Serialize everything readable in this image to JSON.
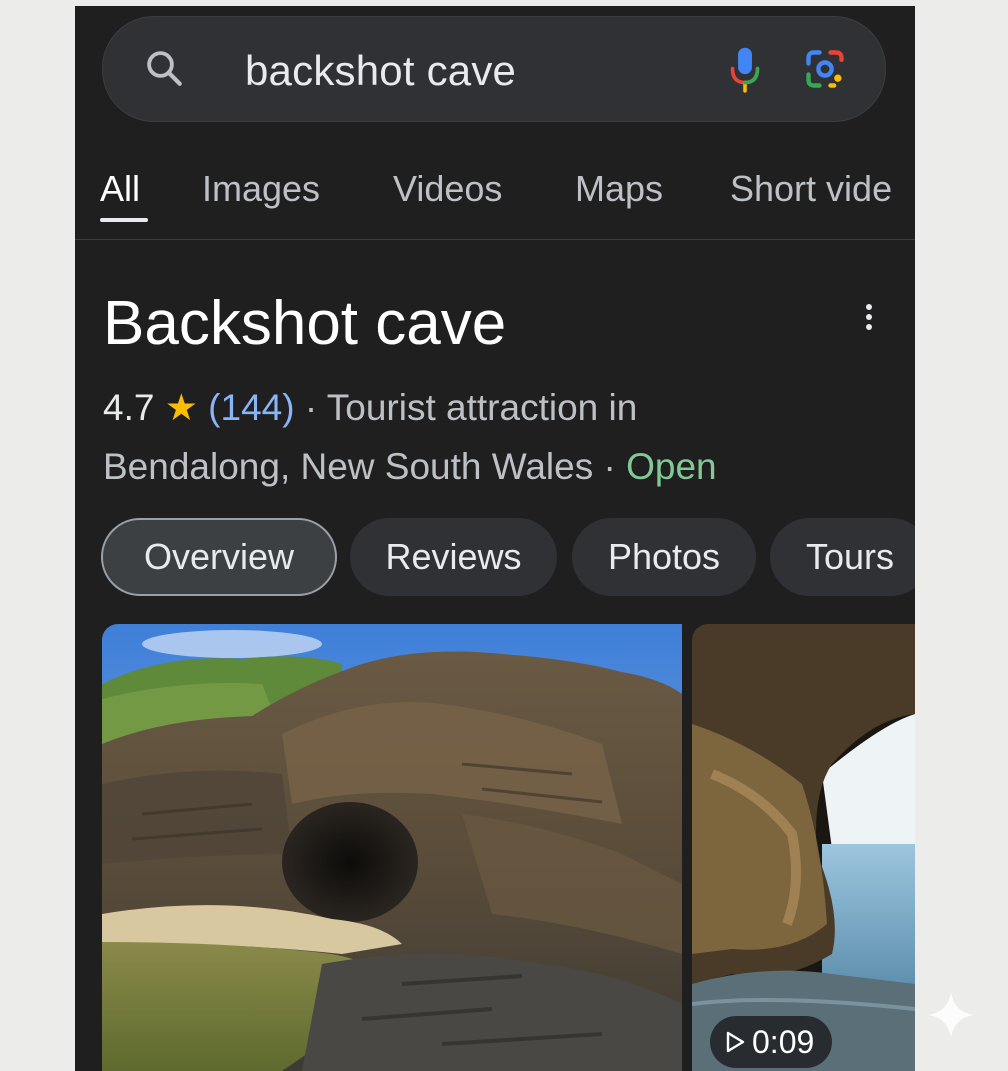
{
  "search": {
    "query": "backshot cave"
  },
  "tabs": [
    {
      "label": "All",
      "active": true
    },
    {
      "label": "Images",
      "active": false
    },
    {
      "label": "Videos",
      "active": false
    },
    {
      "label": "Maps",
      "active": false
    },
    {
      "label": "Short vide",
      "active": false
    }
  ],
  "place": {
    "title": "Backshot cave",
    "rating": "4.7",
    "star": "★",
    "review_count": "(144)",
    "category_text": " · Tourist attraction in",
    "location": "Bendalong, New South Wales",
    "separator": " · ",
    "status": "Open"
  },
  "chips": [
    {
      "label": "Overview",
      "active": true
    },
    {
      "label": "Reviews",
      "active": false
    },
    {
      "label": "Photos",
      "active": false
    },
    {
      "label": "Tours",
      "active": false
    }
  ],
  "media": {
    "video_duration": "0:09"
  },
  "colors": {
    "background": "#1f1f1f",
    "search_bar": "#303134",
    "link_blue": "#8ab4f8",
    "open_green": "#81c995",
    "star_yellow": "#fbbc04"
  },
  "icons": [
    "search-icon",
    "mic-icon",
    "lens-icon",
    "more-vert-icon",
    "play-icon",
    "sparkle-icon"
  ]
}
